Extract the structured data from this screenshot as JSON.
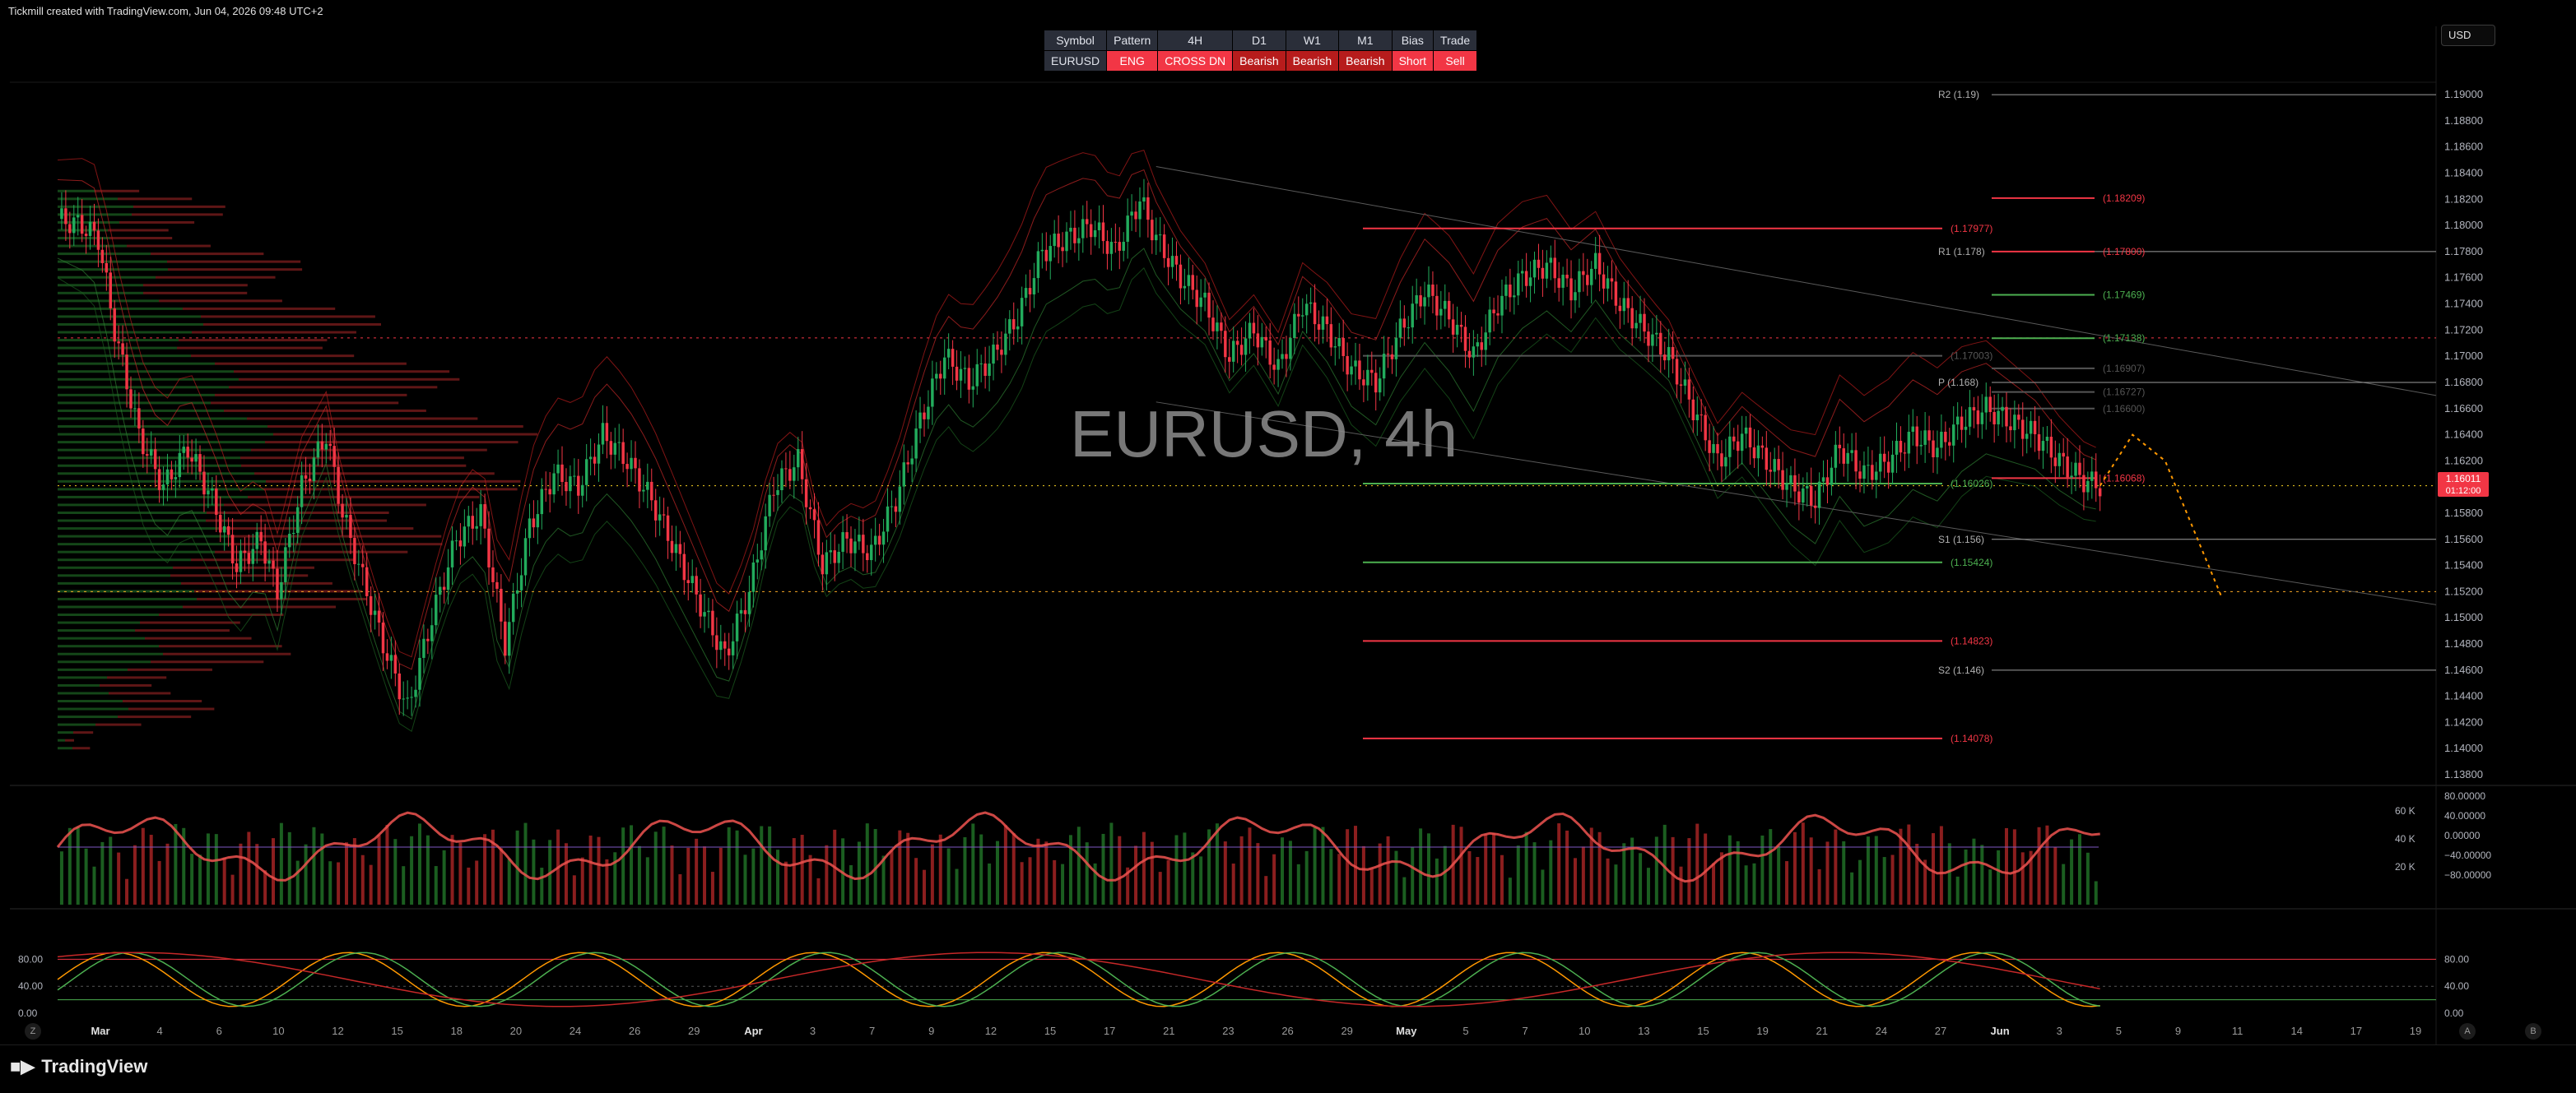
{
  "header": {
    "credit": "Tickmill created with TradingView.com, Jun 04, 2026 09:48 UTC+2",
    "currency": "USD"
  },
  "signal_table": {
    "headers": [
      "Symbol",
      "Pattern",
      "4H",
      "D1",
      "W1",
      "M1",
      "Bias",
      "Trade"
    ],
    "values": [
      "EURUSD",
      "ENG",
      "CROSS DN",
      "Bearish",
      "Bearish",
      "Bearish",
      "Short",
      "Sell"
    ]
  },
  "watermark": "EURUSD, 4h",
  "footer": {
    "brand": "TradingView",
    "left_button": "Z",
    "right_buttons": [
      "A",
      "B"
    ]
  },
  "colors": {
    "bull": "#22ab5c",
    "bear": "#f23645",
    "background": "#000000",
    "rsi_line": "#ff9800"
  },
  "chart_data": {
    "type": "candlestick",
    "symbol": "EURUSD",
    "timeframe": "4h",
    "price_ticks": [
      "1.19000",
      "1.18800",
      "1.18600",
      "1.18400",
      "1.18200",
      "1.18000",
      "1.17800",
      "1.17600",
      "1.17400",
      "1.17200",
      "1.17000",
      "1.16800",
      "1.16600",
      "1.16400",
      "1.16200",
      "1.16000",
      "1.15800",
      "1.15600",
      "1.15400",
      "1.15200",
      "1.15000",
      "1.14800",
      "1.14600",
      "1.14400",
      "1.14200",
      "1.14000",
      "1.13800"
    ],
    "price_range": [
      1.1375,
      1.1912
    ],
    "x_ticks": [
      "Mar",
      "4",
      "6",
      "10",
      "12",
      "15",
      "18",
      "20",
      "24",
      "26",
      "29",
      "Apr",
      "3",
      "7",
      "9",
      "12",
      "15",
      "17",
      "21",
      "23",
      "26",
      "29",
      "May",
      "5",
      "7",
      "10",
      "13",
      "15",
      "19",
      "21",
      "24",
      "27",
      "Jun",
      "3",
      "5",
      "9",
      "11",
      "14",
      "17",
      "19"
    ],
    "current_price": "1.16011",
    "countdown": "01:12:00",
    "pivots": [
      {
        "label": "R2 (1.19)",
        "value": 1.19
      },
      {
        "label": "R1 (1.178)",
        "value": 1.178
      },
      {
        "label": "P (1.168)",
        "value": 1.168
      },
      {
        "label": "S1 (1.156)",
        "value": 1.156
      },
      {
        "label": "S2 (1.146)",
        "value": 1.146
      }
    ],
    "levels": [
      {
        "label": "(1.18209)",
        "value": 1.18209,
        "color": "red"
      },
      {
        "label": "(1.17977)",
        "value": 1.17977,
        "color": "red"
      },
      {
        "label": "(1.17800)",
        "value": 1.178,
        "color": "red"
      },
      {
        "label": "(1.17469)",
        "value": 1.17469,
        "color": "green"
      },
      {
        "label": "(1.17138)",
        "value": 1.17138,
        "color": "green"
      },
      {
        "label": "(1.17003)",
        "value": 1.17003,
        "color": "gray"
      },
      {
        "label": "(1.16907)",
        "value": 1.16907,
        "color": "gray"
      },
      {
        "label": "(1.16727)",
        "value": 1.16727,
        "color": "gray"
      },
      {
        "label": "(1.16600)",
        "value": 1.166,
        "color": "gray"
      },
      {
        "label": "(1.16026)",
        "value": 1.16026,
        "color": "green"
      },
      {
        "label": "(1.16068)",
        "value": 1.16068,
        "color": "red"
      },
      {
        "label": "(1.15424)",
        "value": 1.15424,
        "color": "green"
      },
      {
        "label": "(1.14823)",
        "value": 1.14823,
        "color": "red"
      },
      {
        "label": "(1.14078)",
        "value": 1.14078,
        "color": "red"
      }
    ],
    "close_path": [
      [
        0,
        1.1805
      ],
      [
        6,
        1.18
      ],
      [
        10,
        1.179
      ],
      [
        14,
        1.172
      ],
      [
        20,
        1.164
      ],
      [
        26,
        1.16
      ],
      [
        32,
        1.163
      ],
      [
        38,
        1.159
      ],
      [
        44,
        1.154
      ],
      [
        50,
        1.156
      ],
      [
        54,
        1.152
      ],
      [
        60,
        1.16
      ],
      [
        66,
        1.164
      ],
      [
        70,
        1.158
      ],
      [
        76,
        1.152
      ],
      [
        80,
        1.148
      ],
      [
        86,
        1.143
      ],
      [
        92,
        1.15
      ],
      [
        98,
        1.156
      ],
      [
        104,
        1.158
      ],
      [
        110,
        1.148
      ],
      [
        116,
        1.157
      ],
      [
        122,
        1.161
      ],
      [
        128,
        1.16
      ],
      [
        134,
        1.164
      ],
      [
        140,
        1.162
      ],
      [
        146,
        1.159
      ],
      [
        152,
        1.155
      ],
      [
        158,
        1.151
      ],
      [
        164,
        1.147
      ],
      [
        170,
        1.152
      ],
      [
        176,
        1.16
      ],
      [
        182,
        1.162
      ],
      [
        188,
        1.154
      ],
      [
        194,
        1.156
      ],
      [
        200,
        1.155
      ],
      [
        206,
        1.159
      ],
      [
        212,
        1.165
      ],
      [
        218,
        1.17
      ],
      [
        224,
        1.168
      ],
      [
        230,
        1.17
      ],
      [
        236,
        1.173
      ],
      [
        242,
        1.178
      ],
      [
        248,
        1.179
      ],
      [
        254,
        1.18
      ],
      [
        260,
        1.178
      ],
      [
        266,
        1.182
      ],
      [
        270,
        1.179
      ],
      [
        276,
        1.176
      ],
      [
        282,
        1.174
      ],
      [
        288,
        1.17
      ],
      [
        294,
        1.172
      ],
      [
        300,
        1.169
      ],
      [
        306,
        1.174
      ],
      [
        312,
        1.172
      ],
      [
        318,
        1.169
      ],
      [
        324,
        1.168
      ],
      [
        330,
        1.172
      ],
      [
        336,
        1.175
      ],
      [
        342,
        1.173
      ],
      [
        348,
        1.17
      ],
      [
        354,
        1.174
      ],
      [
        360,
        1.176
      ],
      [
        366,
        1.177
      ],
      [
        372,
        1.175
      ],
      [
        378,
        1.177
      ],
      [
        384,
        1.174
      ],
      [
        390,
        1.172
      ],
      [
        396,
        1.17
      ],
      [
        402,
        1.166
      ],
      [
        408,
        1.162
      ],
      [
        414,
        1.164
      ],
      [
        420,
        1.162
      ],
      [
        426,
        1.16
      ],
      [
        432,
        1.159
      ],
      [
        438,
        1.163
      ],
      [
        444,
        1.161
      ],
      [
        450,
        1.162
      ],
      [
        456,
        1.164
      ],
      [
        462,
        1.163
      ],
      [
        468,
        1.165
      ],
      [
        474,
        1.166
      ],
      [
        480,
        1.165
      ],
      [
        486,
        1.164
      ],
      [
        492,
        1.162
      ],
      [
        498,
        1.1605
      ],
      [
        502,
        1.1601
      ]
    ],
    "projection": [
      [
        502,
        1.1601
      ],
      [
        510,
        1.164
      ],
      [
        518,
        1.162
      ],
      [
        526,
        1.156
      ],
      [
        532,
        1.1515
      ]
    ],
    "volume_panel": {
      "ticks": [
        "60 K",
        "40 K",
        "20 K"
      ],
      "oscillator_ticks": [
        "80.00000",
        "40.00000",
        "0.00000",
        "−40.00000",
        "−80.00000"
      ]
    },
    "stoch_panel": {
      "ticks": [
        "80.00",
        "40.00",
        "0.00"
      ]
    }
  }
}
